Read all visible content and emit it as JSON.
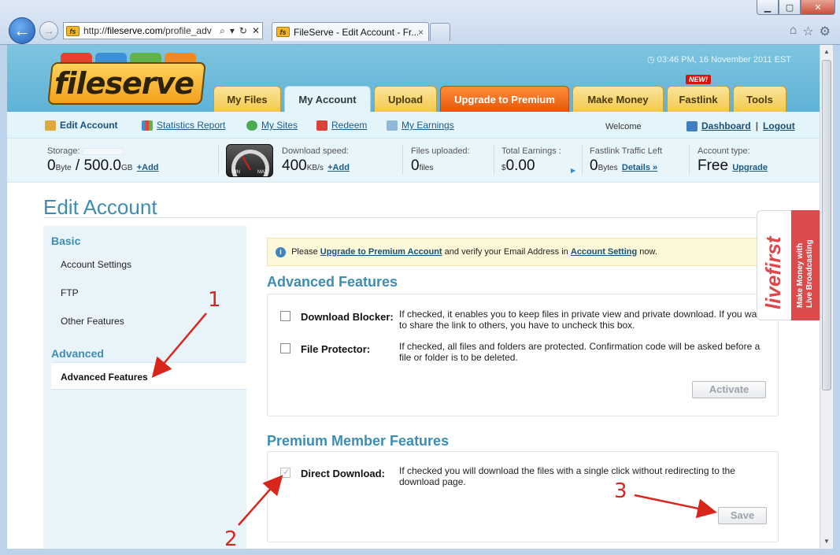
{
  "browser": {
    "url_prefix": "http://",
    "url_domain": "fileserve.com",
    "url_path": "/profile_adv",
    "tab_title": "FileServe - Edit Account - Fr...",
    "tab_close": "×",
    "win_min": "▁",
    "win_max": "▢",
    "win_close": "✕"
  },
  "header": {
    "logo": "fileserve",
    "clock": "03:46 PM, 16 November 2011 EST",
    "tabs": [
      "My Files",
      "My Account",
      "Upload",
      "Upgrade to Premium",
      "Make Money",
      "Fastlink",
      "Tools"
    ],
    "new_badge": "NEW!"
  },
  "subnav": {
    "edit_account": "Edit Account",
    "statistics_report": "Statistics Report",
    "my_sites": "My Sites",
    "redeem": "Redeem",
    "my_earnings": "My Earnings",
    "welcome": "Welcome",
    "dashboard": "Dashboard",
    "separator": "|",
    "logout": "Logout"
  },
  "stats": {
    "storage_label": "Storage:",
    "storage_used": "0",
    "storage_used_unit": "Byte",
    "storage_slash": "/",
    "storage_total": "500.0",
    "storage_total_unit": "GB",
    "storage_add": "+Add",
    "gauge_min": "MIN",
    "gauge_max": "MAX",
    "speed_label": "Download speed:",
    "speed_value": "400",
    "speed_unit": "KB/s",
    "speed_add": "+Add",
    "files_label": "Files uploaded:",
    "files_value": "0",
    "files_unit": "files",
    "earnings_label": "Total Earnings :",
    "earnings_currency": "$",
    "earnings_value": "0.00",
    "traffic_label": "Fastlink Traffic Left",
    "traffic_value": "0",
    "traffic_unit": "Bytes",
    "traffic_details": "Details »",
    "account_label": "Account type:",
    "account_value": "Free",
    "account_upgrade": "Upgrade"
  },
  "page": {
    "title": "Edit Account",
    "sidebar": {
      "basic_heading": "Basic",
      "basic_items": [
        "Account Settings",
        "FTP",
        "Other Features"
      ],
      "advanced_heading": "Advanced",
      "advanced_active": "Advanced Features"
    },
    "notice": {
      "prefix": "Please",
      "link1": "Upgrade to Premium Account",
      "middle": "and verify your Email Address in",
      "link2": "Account Setting",
      "suffix": "now."
    },
    "advanced": {
      "heading": "Advanced Features",
      "rows": [
        {
          "label": "Download Blocker:",
          "desc": "If checked, it enables you to keep files in private view and private download. If you want to share the link to others, you have to uncheck this box."
        },
        {
          "label": "File Protector:",
          "desc": "If checked, all files and folders are protected. Confirmation code will be asked before a file or folder is to be deleted."
        }
      ],
      "button": "Activate"
    },
    "premium": {
      "heading": "Premium Member Features",
      "row": {
        "label": "Direct Download:",
        "desc": "If checked you will download the files with a single click without redirecting to the download page."
      },
      "button": "Save"
    }
  },
  "ad": {
    "brand": "livefirst",
    "line1": "Make Money with",
    "line2": "Live Broadcasting"
  },
  "annotations": [
    "1",
    "2",
    "3"
  ]
}
